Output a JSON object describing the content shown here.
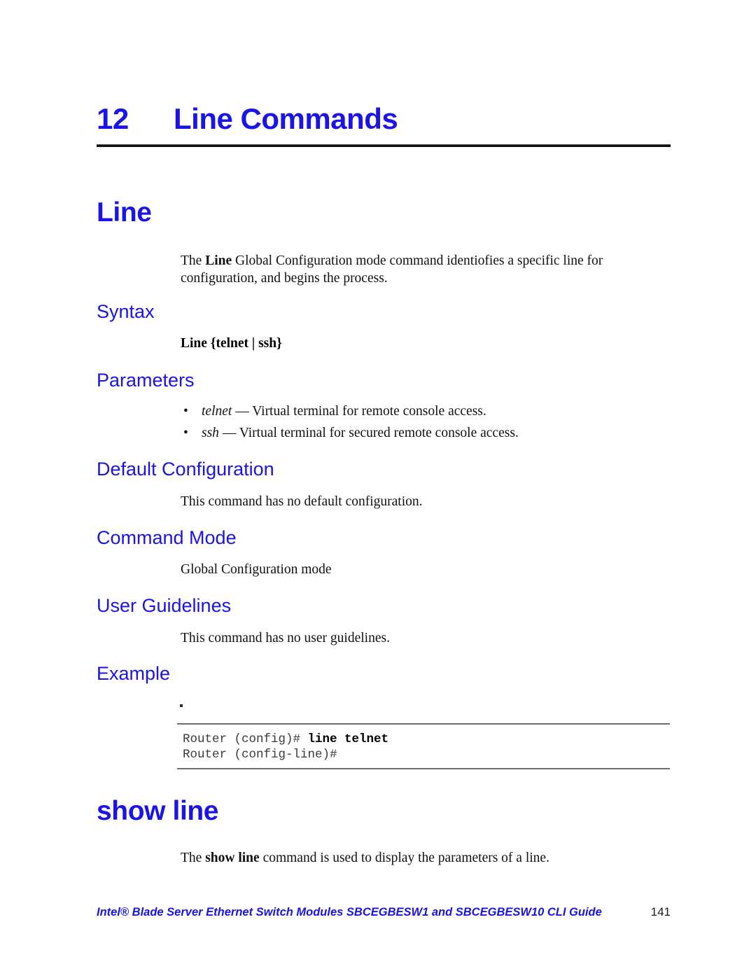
{
  "document": {
    "chapter": {
      "number": "12",
      "title": "Line Commands"
    },
    "sections": [
      {
        "heading": "Line",
        "intro_prefix": "The ",
        "intro_bold": "Line",
        "intro_suffix": " Global Configuration mode command identiofies a specific line for configuration, and begins the process.",
        "subheadings": {
          "syntax": "Syntax",
          "parameters": "Parameters",
          "default_configuration": "Default Configuration",
          "command_mode": "Command Mode",
          "user_guidelines": "User Guidelines",
          "example": "Example"
        },
        "syntax_text": "Line {telnet | ssh}",
        "parameters": [
          {
            "bullet": "•",
            "name": "telnet",
            "separator": " — ",
            "description": "Virtual terminal for remote console access."
          },
          {
            "bullet": "•",
            "name": "ssh",
            "separator": " — ",
            "description": "Virtual terminal for secured remote console access."
          }
        ],
        "default_configuration_text": "This command has no default configuration.",
        "command_mode_text": "Global Configuration mode",
        "user_guidelines_text": "This command has no user guidelines.",
        "example": {
          "line1_prompt": "Router (config)# ",
          "line1_command": "line telnet",
          "line2_prompt": "Router (config-line)#"
        }
      },
      {
        "heading": "show line",
        "intro_prefix": "The ",
        "intro_bold": "show line",
        "intro_suffix": " command is used to display the parameters of a line."
      }
    ],
    "footer": {
      "title": "Intel® Blade Server Ethernet Switch Modules SBCEGBESW1 and SBCEGBESW10 CLI Guide",
      "page_number": "141"
    },
    "colors": {
      "heading_blue": "#1a14e6",
      "body_black": "#111111",
      "code_gray": "#3b3b3b",
      "rule_gray": "#6e6e6e",
      "rule_black": "#111111"
    }
  }
}
